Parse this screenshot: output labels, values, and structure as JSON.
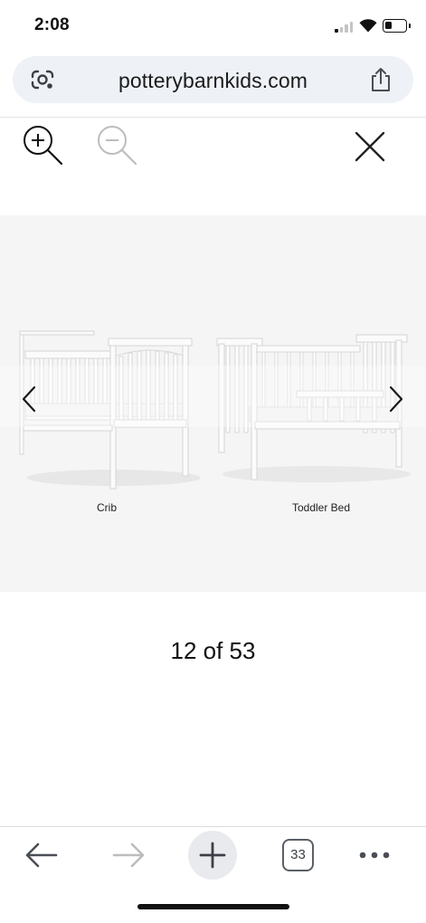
{
  "status_bar": {
    "time": "2:08",
    "signal_bars_active": 1,
    "battery_level": 0.3
  },
  "browser": {
    "url": "potterybarnkids.com",
    "icons": {
      "lens": "google-lens-icon",
      "share": "share-icon"
    }
  },
  "viewer_toolbar": {
    "icons": {
      "zoom_in": "zoom-in-icon",
      "zoom_out": "zoom-out-icon",
      "close": "close-icon"
    }
  },
  "image": {
    "captions": {
      "left": "Crib",
      "right": "Toddler Bed"
    },
    "icons": {
      "prev": "chevron-left-icon",
      "next": "chevron-right-icon"
    }
  },
  "pagination": {
    "text": "12 of 53"
  },
  "bottom_toolbar": {
    "tab_count": "33",
    "icons": {
      "back": "back-arrow-icon",
      "forward": "forward-arrow-icon",
      "new_tab": "plus-icon",
      "tabs": "tab-switcher-icon",
      "more": "more-icon"
    }
  },
  "colors": {
    "panel_bg": "#f5f5f5",
    "url_bar_bg": "#eef1f6",
    "new_tab_bg": "#e8eaee",
    "disabled_icon": "#bdbdbd"
  }
}
